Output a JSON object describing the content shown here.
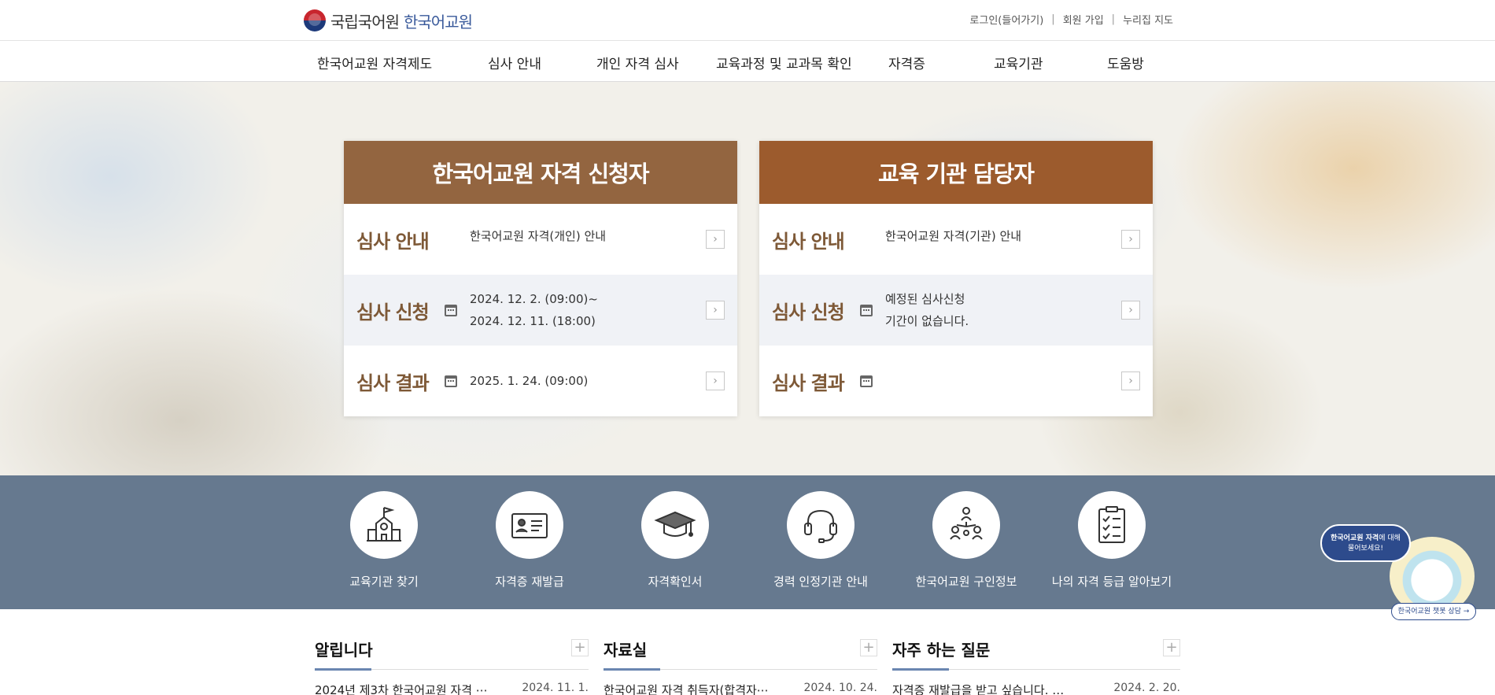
{
  "header": {
    "logo_org": "국립국어원",
    "logo_site": "한국어교원",
    "util": [
      "로그인(들어가기)",
      "회원 가입",
      "누리집 지도"
    ]
  },
  "nav": [
    "한국어교원 자격제도",
    "심사 안내",
    "개인 자격 심사",
    "교육과정 및 교과목 확인",
    "자격증",
    "교육기관",
    "도움방"
  ],
  "cards": [
    {
      "title": "한국어교원 자격 신청자",
      "rows": [
        {
          "title": "심사 안내",
          "lines": [
            "한국어교원 자격(개인) 안내"
          ]
        },
        {
          "title": "심사 신청",
          "lines": [
            "2024. 12. 2. (09:00)~",
            "2024. 12. 11. (18:00)"
          ]
        },
        {
          "title": "심사 결과",
          "lines": [
            "2025. 1. 24. (09:00)"
          ]
        }
      ]
    },
    {
      "title": "교육 기관 담당자",
      "rows": [
        {
          "title": "심사 안내",
          "lines": [
            "한국어교원 자격(기관) 안내"
          ]
        },
        {
          "title": "심사 신청",
          "lines": [
            "예정된 심사신청",
            "기간이 없습니다."
          ]
        },
        {
          "title": "심사 결과",
          "lines": []
        }
      ]
    }
  ],
  "quick_menu": [
    {
      "label": "교육기관 찾기",
      "icon": "school-icon"
    },
    {
      "label": "자격증 재발급",
      "icon": "id-card-icon"
    },
    {
      "label": "자격확인서",
      "icon": "graduation-cap-icon"
    },
    {
      "label": "경력 인정기관 안내",
      "icon": "headset-icon"
    },
    {
      "label": "한국어교원 구인정보",
      "icon": "people-network-icon"
    },
    {
      "label": "나의 자격 등급 알아보기",
      "icon": "checklist-icon"
    }
  ],
  "chatbot": {
    "bubble_bold": "한국어교원 자격",
    "bubble_rest": "에 대해",
    "bubble_line2": "물어보세요!",
    "button": "한국어교원 챗봇 상담 →"
  },
  "boards": [
    {
      "title": "알립니다",
      "more": "+",
      "item": "2024년 제3차 한국어교원 자격 ⋯",
      "date": "2024. 11. 1."
    },
    {
      "title": "자료실",
      "more": "+",
      "item": "한국어교원 자격 취득자(합격자⋯",
      "date": "2024. 10. 24."
    },
    {
      "title": "자주 하는 질문",
      "more": "+",
      "item": "자격증 재발급을 받고 싶습니다. 수⋯",
      "date": "2024. 2. 20."
    }
  ],
  "colors": {
    "card_left_header": "#936540",
    "card_right_header": "#9c5b2d",
    "row_title": "#7e5937",
    "quick_band": "#66798f",
    "board_accent": "#6a86b0"
  }
}
